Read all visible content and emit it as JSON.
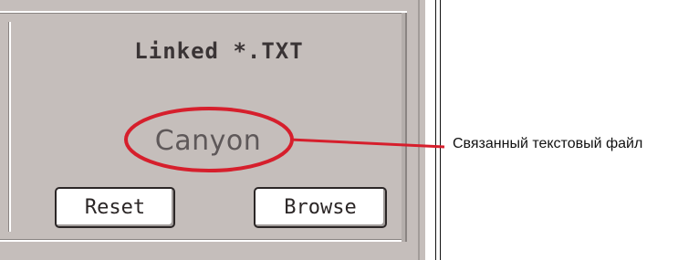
{
  "panel": {
    "title": "Linked *.TXT",
    "linked_file_name": "Canyon",
    "buttons": {
      "reset_label": "Reset",
      "browse_label": "Browse"
    }
  },
  "annotation": {
    "callout_text": "Связанный текстовый файл",
    "highlight_color": "#d61f2c"
  },
  "colors": {
    "panel_background": "#c5bebb",
    "button_background": "#ffffff",
    "text_dark": "#3a3435"
  }
}
